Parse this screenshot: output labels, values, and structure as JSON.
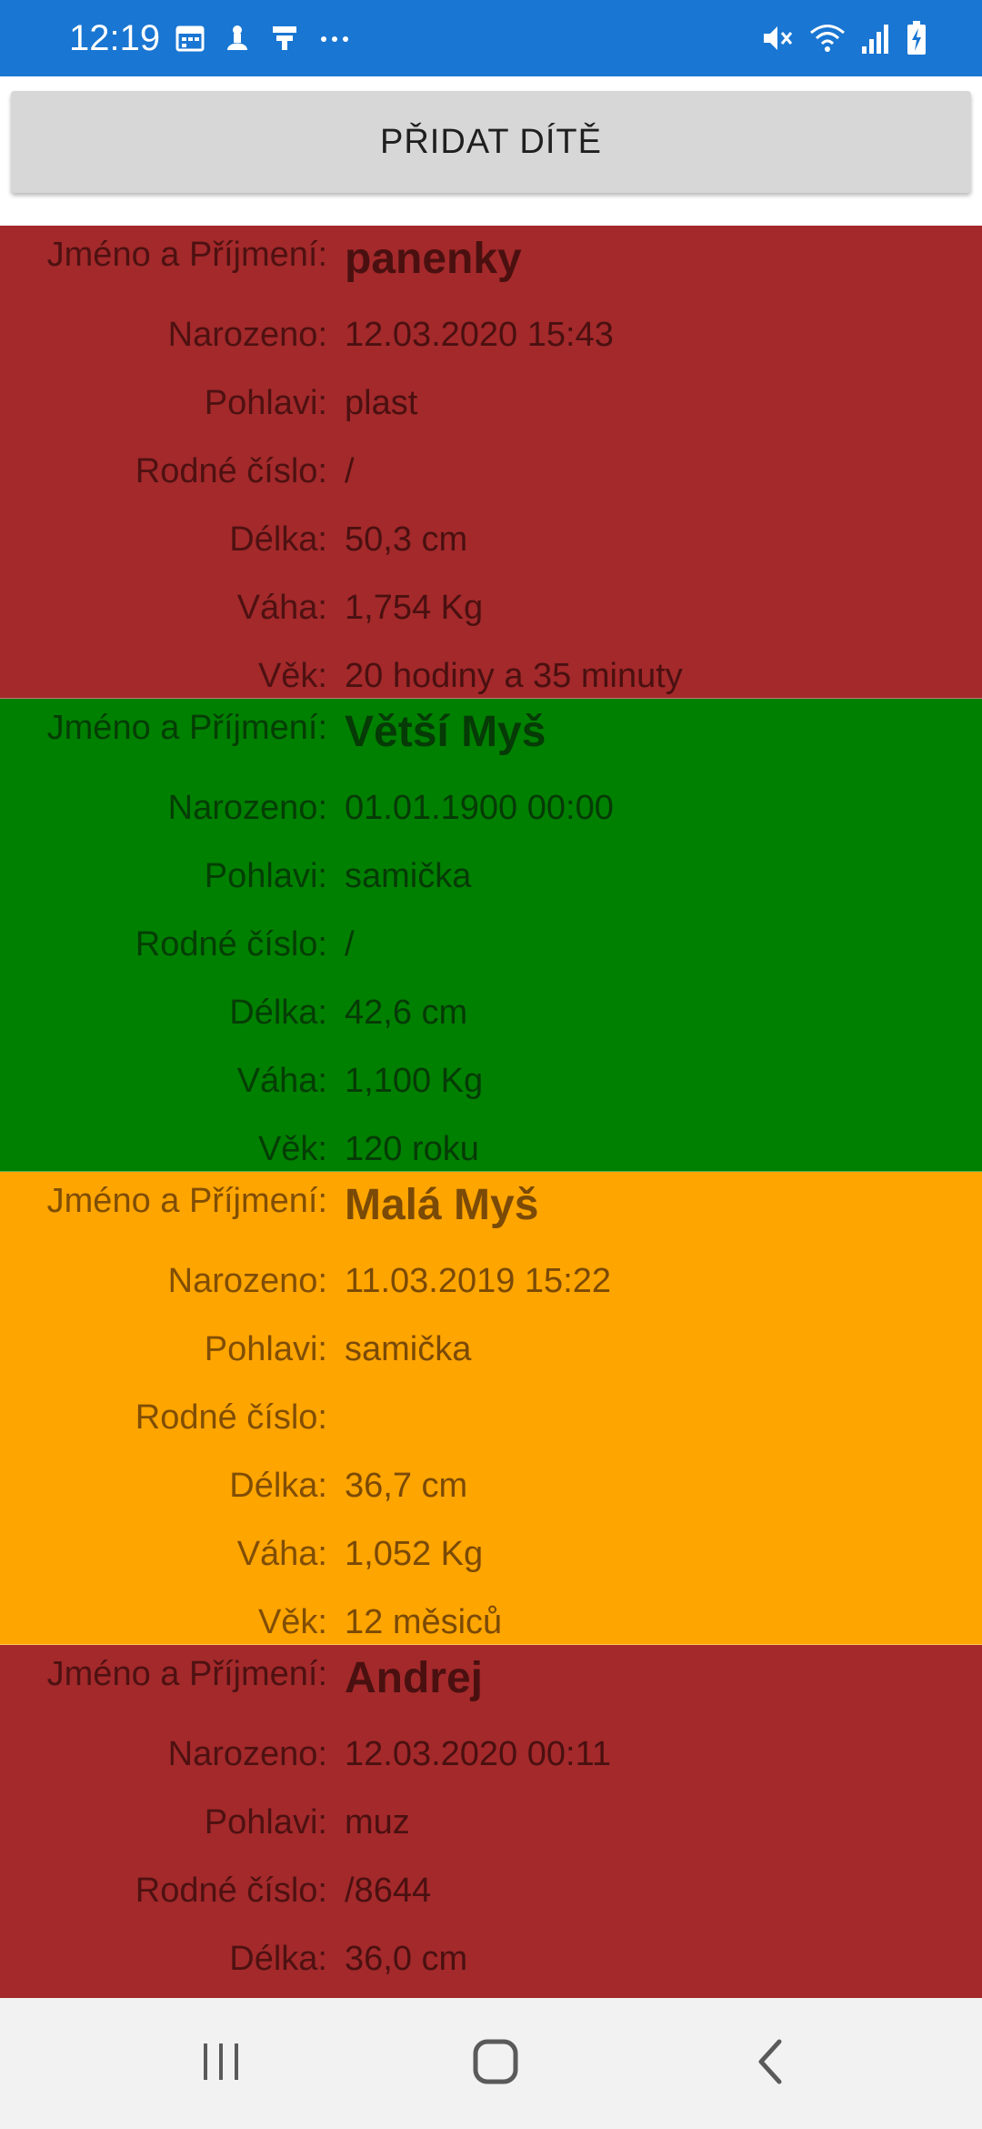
{
  "status_bar": {
    "time": "12:19",
    "left_icons": [
      "calendar-icon",
      "app-notification-icon",
      "cast-icon",
      "more-notifications-icon"
    ],
    "right_icons": [
      "mute-icon",
      "wifi-icon",
      "signal-icon",
      "battery-charging-icon"
    ],
    "color": "#1976d2"
  },
  "add_button": {
    "label": "PŘIDAT DÍTĚ"
  },
  "labels": {
    "name": "Jméno a Příjmení:",
    "born": "Narozeno:",
    "sex": "Pohlavi:",
    "birth_number": "Rodné číslo:",
    "length": "Délka:",
    "weight": "Váha:",
    "age": "Věk:"
  },
  "children": [
    {
      "name": "panenky",
      "born": "12.03.2020 15:43",
      "sex": "plast",
      "birth_number": "/",
      "length": "50,3 cm",
      "weight": "1,754 Kg",
      "age": "20 hodiny a 35 minuty",
      "bg_color": "#a3292b",
      "text_color": "#4a1010"
    },
    {
      "name": "Větší Myš",
      "born": "01.01.1900 00:00",
      "sex": "samička",
      "birth_number": "/",
      "length": "42,6 cm",
      "weight": "1,100 Kg",
      "age": "120 roku",
      "bg_color": "#008000",
      "text_color": "#063a06"
    },
    {
      "name": "Malá Myš",
      "born": "11.03.2019 15:22",
      "sex": "samička",
      "birth_number": "",
      "length": "36,7 cm",
      "weight": "1,052 Kg",
      "age": "12 měsiců",
      "bg_color": "#ffa500",
      "text_color": "#7a4a06"
    },
    {
      "name": "Andrej",
      "born": "12.03.2020 00:11",
      "sex": "muz",
      "birth_number": "/8644",
      "length": "36,0 cm",
      "weight": "",
      "age": "",
      "bg_color": "#a3292b",
      "text_color": "#4a1010"
    }
  ],
  "nav_bar": {
    "buttons": [
      "recent-apps-icon",
      "home-icon",
      "back-icon"
    ]
  }
}
